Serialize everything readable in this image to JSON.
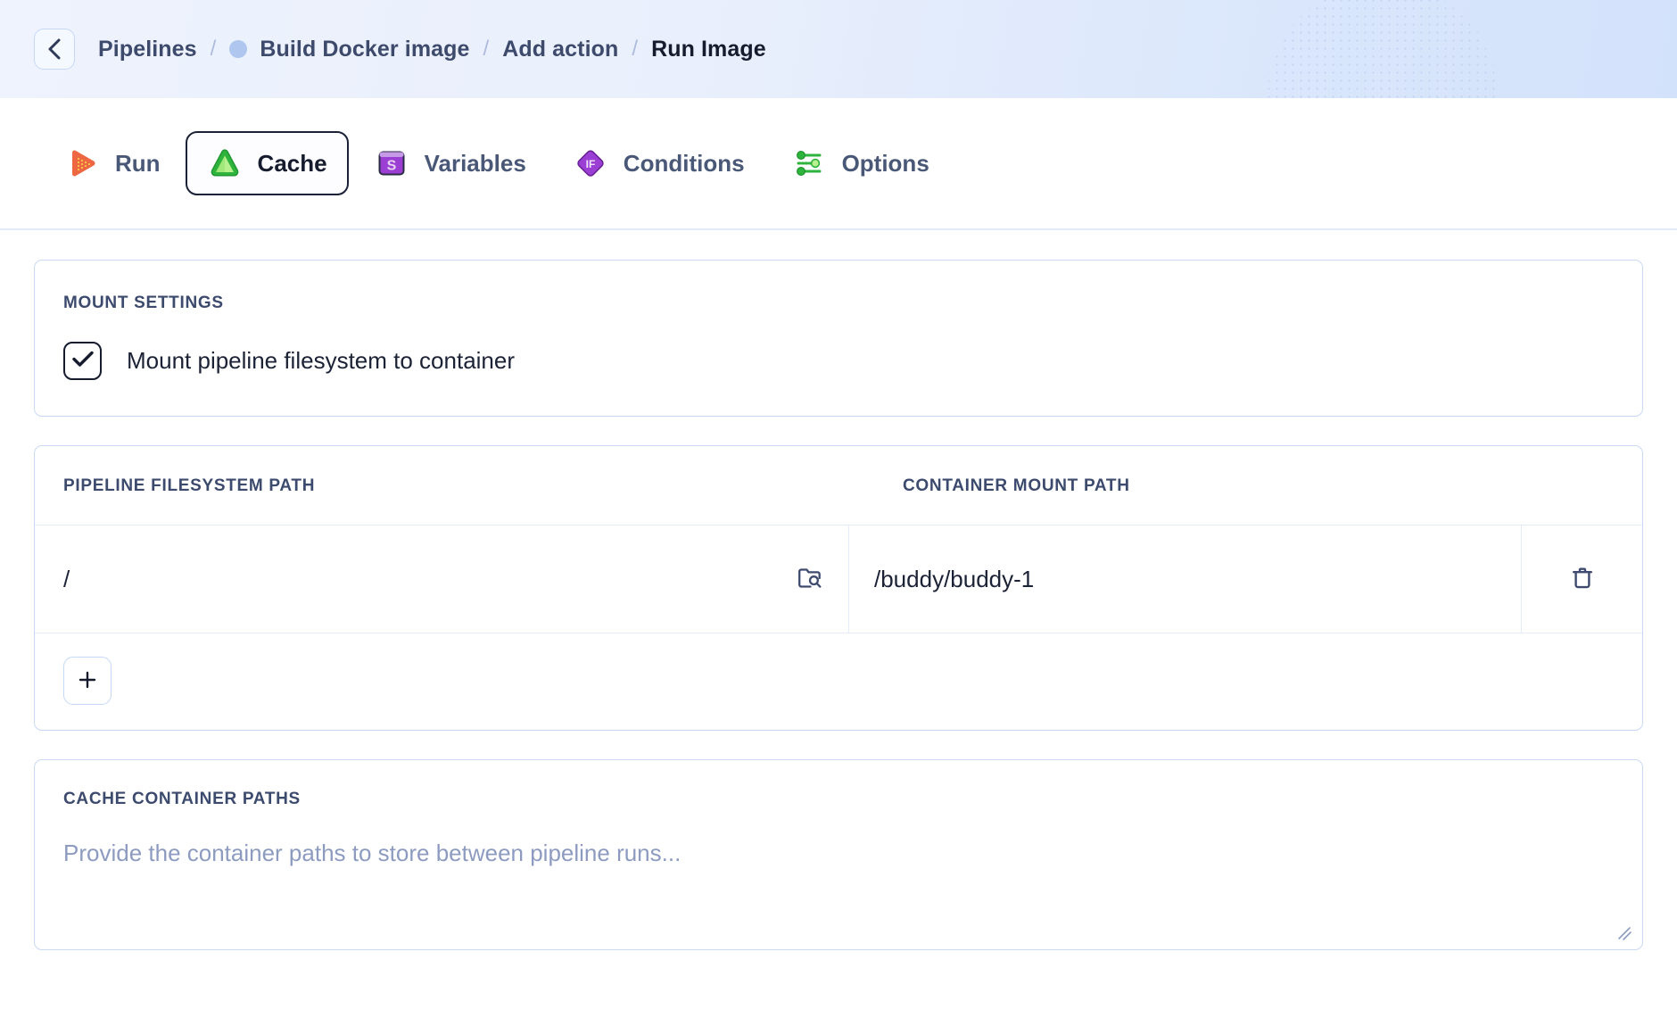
{
  "header": {
    "back_icon": "chevron-left-icon",
    "breadcrumb": [
      {
        "label": "Pipelines",
        "current": false,
        "dot": false
      },
      {
        "label": "Build Docker image",
        "current": false,
        "dot": true
      },
      {
        "label": "Add action",
        "current": false,
        "dot": false
      },
      {
        "label": "Run Image",
        "current": true,
        "dot": false
      }
    ],
    "separator": "/"
  },
  "tabs": [
    {
      "label": "Run",
      "icon": "play-icon",
      "active": false
    },
    {
      "label": "Cache",
      "icon": "cache-triangle-icon",
      "active": true
    },
    {
      "label": "Variables",
      "icon": "dollar-variable-icon",
      "active": false
    },
    {
      "label": "Conditions",
      "icon": "if-diamond-icon",
      "active": false
    },
    {
      "label": "Options",
      "icon": "sliders-icon",
      "active": false
    }
  ],
  "mount_settings": {
    "title": "MOUNT SETTINGS",
    "checkbox": {
      "label": "Mount pipeline filesystem to container",
      "checked": true,
      "icon": "check-icon"
    }
  },
  "mount_table": {
    "columns": [
      "PIPELINE FILESYSTEM PATH",
      "CONTAINER MOUNT PATH"
    ],
    "rows": [
      {
        "pipeline_path": "/",
        "container_path": "/buddy/buddy-1",
        "browse_icon": "folder-search-icon",
        "delete_icon": "trash-icon"
      }
    ],
    "add_button": {
      "label": "+",
      "icon": "plus-icon"
    }
  },
  "cache_container_paths": {
    "title": "CACHE CONTAINER PATHS",
    "placeholder": "Provide the container paths to store between pipeline runs...",
    "value": "",
    "resize_icon": "resize-handle-icon"
  },
  "colors": {
    "accent_orange": "#ec6742",
    "accent_green": "#2eb33c",
    "accent_purple": "#9b3fd4",
    "text_dark": "#161b2e",
    "text_muted": "#3c4a6d",
    "border_light": "#c9d9f5",
    "placeholder": "#8d9bc0",
    "header_gradient_start": "#eef3fd",
    "header_gradient_end": "#d3e2fb"
  }
}
